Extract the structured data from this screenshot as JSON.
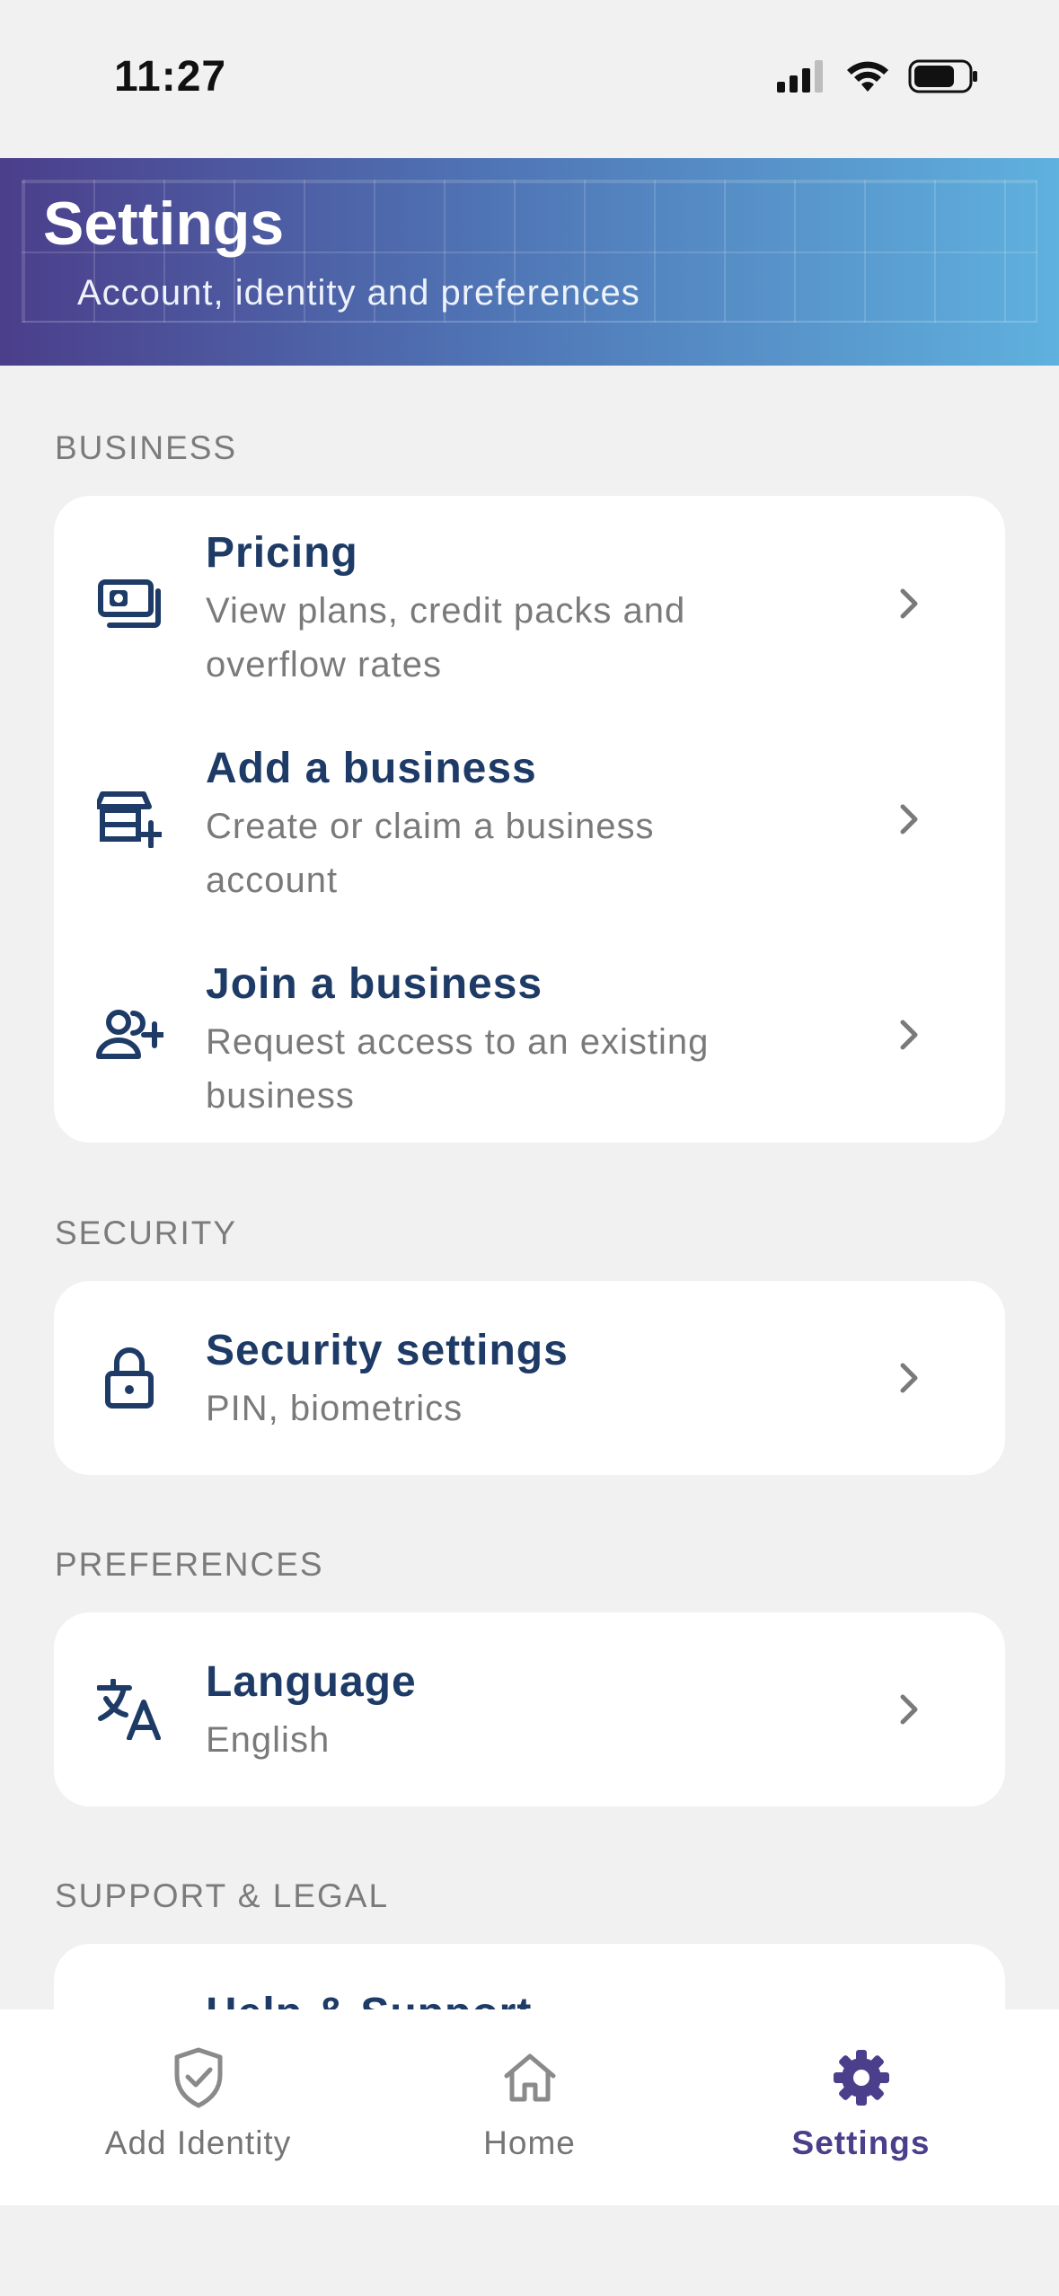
{
  "status_bar": {
    "time": "11:27"
  },
  "header": {
    "title": "Settings",
    "subtitle": "Account, identity and preferences"
  },
  "sections": {
    "business": {
      "label": "BUSINESS",
      "items": [
        {
          "title": "Pricing",
          "desc_line1": "View plans, credit packs and",
          "desc_line2": "overflow rates",
          "icon": "money-icon"
        },
        {
          "title": "Add a business",
          "desc_line1": "Create or claim a business",
          "desc_line2": "account",
          "icon": "store-add-icon"
        },
        {
          "title": "Join a business",
          "desc_line1": "Request access to an existing",
          "desc_line2": "business",
          "icon": "user-add-icon"
        }
      ]
    },
    "security": {
      "label": "SECURITY",
      "items": [
        {
          "title": "Security settings",
          "desc_line1": "PIN, biometrics",
          "icon": "lock-icon"
        }
      ]
    },
    "preferences": {
      "label": "PREFERENCES",
      "items": [
        {
          "title": "Language",
          "desc_line1": "English",
          "icon": "translate-icon"
        }
      ]
    },
    "support": {
      "label": "SUPPORT & LEGAL",
      "items": [
        {
          "title": "Help & Support",
          "icon": "help-icon"
        }
      ]
    }
  },
  "bottom_nav": {
    "items": [
      {
        "label": "Add Identity",
        "icon": "shield-check-icon",
        "active": false
      },
      {
        "label": "Home",
        "icon": "home-icon",
        "active": false
      },
      {
        "label": "Settings",
        "icon": "gear-icon",
        "active": true
      }
    ]
  },
  "colors": {
    "accent": "#4b3e8b",
    "title_text": "#1d3b66",
    "secondary_text": "#7a7a7a",
    "background": "#f1f1f1",
    "header_gradient_start": "#4b3e8b",
    "header_gradient_end": "#5fb1de"
  }
}
